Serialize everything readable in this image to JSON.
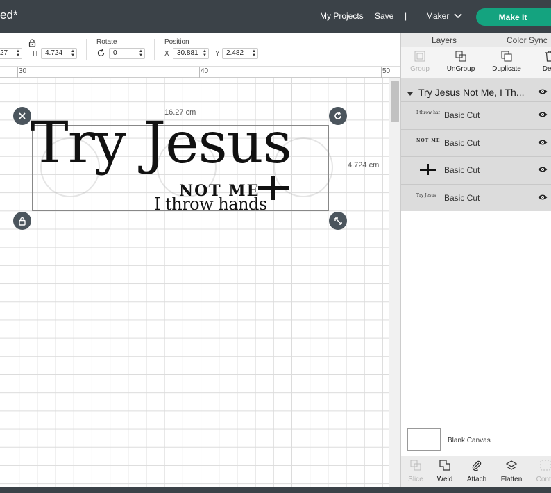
{
  "app": {
    "title_fragment": "ed*",
    "nav": {
      "my_projects": "My Projects",
      "save": "Save",
      "divider": "|",
      "machine": "Maker",
      "make_it": "Make It"
    }
  },
  "toolbar": {
    "size": {
      "w_value_fragment": "27",
      "h_label": "H",
      "h_value": "4.724"
    },
    "rotate": {
      "label": "Rotate",
      "value": "0"
    },
    "position": {
      "label": "Position",
      "x_label": "X",
      "x_value": "30.881",
      "y_label": "Y",
      "y_value": "2.482"
    }
  },
  "ruler": {
    "marks": [
      "30",
      "40",
      "50"
    ]
  },
  "canvas": {
    "width_dim": "16.27 cm",
    "height_dim": "4.724 cm",
    "design": {
      "line1": "Try Jesus",
      "line2": "NOT ME",
      "line3": "I throw hands"
    }
  },
  "panel": {
    "tabs": [
      "Layers",
      "Color Sync"
    ],
    "tools": [
      {
        "label": "Group",
        "icon": "group-icon",
        "enabled": false
      },
      {
        "label": "UnGroup",
        "icon": "ungroup-icon",
        "enabled": true
      },
      {
        "label": "Duplicate",
        "icon": "duplicate-icon",
        "enabled": true
      },
      {
        "label": "Dele",
        "icon": "trash-icon",
        "enabled": true
      }
    ],
    "group_title": "Try Jesus Not Me, I Th...",
    "layers": [
      {
        "thumb": "I throw hands",
        "name": "Basic Cut"
      },
      {
        "thumb": "NOT ME",
        "name": "Basic Cut"
      },
      {
        "thumb": "cross",
        "name": "Basic Cut"
      },
      {
        "thumb": "Try Jesus",
        "name": "Basic Cut"
      }
    ],
    "blank_canvas": "Blank Canvas",
    "bottom_tools": [
      {
        "label": "Slice",
        "icon": "slice-icon",
        "enabled": false
      },
      {
        "label": "Weld",
        "icon": "weld-icon",
        "enabled": true
      },
      {
        "label": "Attach",
        "icon": "attach-icon",
        "enabled": true
      },
      {
        "label": "Flatten",
        "icon": "flatten-icon",
        "enabled": true
      },
      {
        "label": "Conto",
        "icon": "contour-icon",
        "enabled": false
      }
    ]
  },
  "colors": {
    "topbar": "#3b4248",
    "accent": "#14a37f",
    "handle": "#4b555d",
    "layers_bg": "#dcdcdc"
  }
}
